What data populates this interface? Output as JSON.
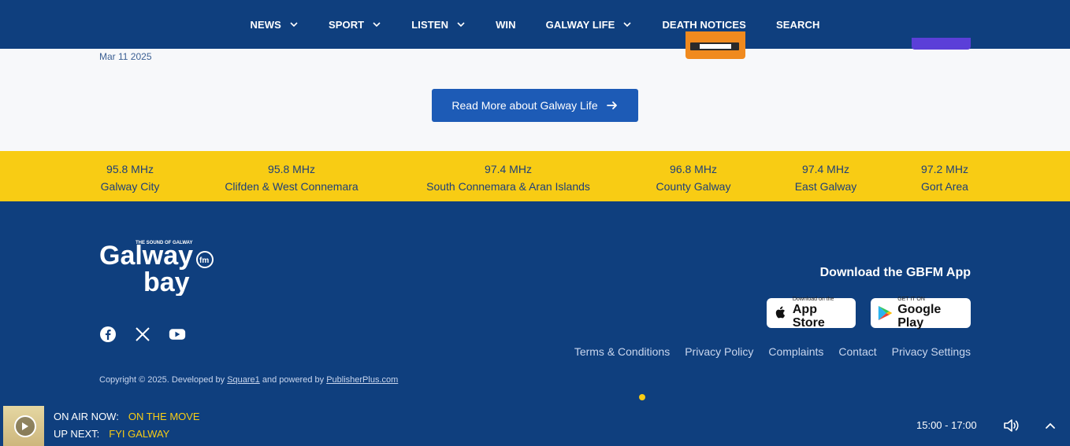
{
  "nav": {
    "items": [
      {
        "label": "NEWS",
        "dropdown": true
      },
      {
        "label": "SPORT",
        "dropdown": true
      },
      {
        "label": "LISTEN",
        "dropdown": true
      },
      {
        "label": "WIN",
        "dropdown": false
      },
      {
        "label": "GALWAY LIFE",
        "dropdown": true
      },
      {
        "label": "DEATH NOTICES",
        "dropdown": false
      },
      {
        "label": "SEARCH",
        "dropdown": false
      }
    ]
  },
  "article": {
    "date": "Mar 11 2025"
  },
  "read_more": {
    "label": "Read More about Galway Life"
  },
  "frequencies": [
    {
      "freq": "95.8 MHz",
      "area": "Galway City"
    },
    {
      "freq": "95.8 MHz",
      "area": "Clifden & West Connemara"
    },
    {
      "freq": "97.4 MHz",
      "area": "South Connemara & Aran Islands"
    },
    {
      "freq": "96.8 MHz",
      "area": "County Galway"
    },
    {
      "freq": "97.4 MHz",
      "area": "East Galway"
    },
    {
      "freq": "97.2 MHz",
      "area": "Gort Area"
    }
  ],
  "footer": {
    "logo_text": "Galway bay fm",
    "logo_tagline": "THE SOUND OF GALWAY",
    "download_title": "Download the GBFM App",
    "app_store": {
      "small": "Download on the",
      "large": "App Store"
    },
    "google_play": {
      "small": "GET IT ON",
      "large": "Google Play"
    },
    "links": [
      "Terms & Conditions",
      "Privacy Policy",
      "Complaints",
      "Contact",
      "Privacy Settings"
    ],
    "copyright_prefix": "Copyright © 2025. Developed by ",
    "developer": "Square1",
    "powered_prefix": " and powered by ",
    "powered_by": "PublisherPlus.com"
  },
  "player": {
    "on_air_label": "ON AIR NOW:",
    "on_air_value": "ON THE MOVE",
    "up_next_label": "UP NEXT:",
    "up_next_value": "FYI GALWAY",
    "time": "15:00 - 17:00"
  },
  "colors": {
    "navy": "#0f3f7e",
    "yellow": "#f8cc14",
    "button_blue": "#1d5bb6"
  }
}
